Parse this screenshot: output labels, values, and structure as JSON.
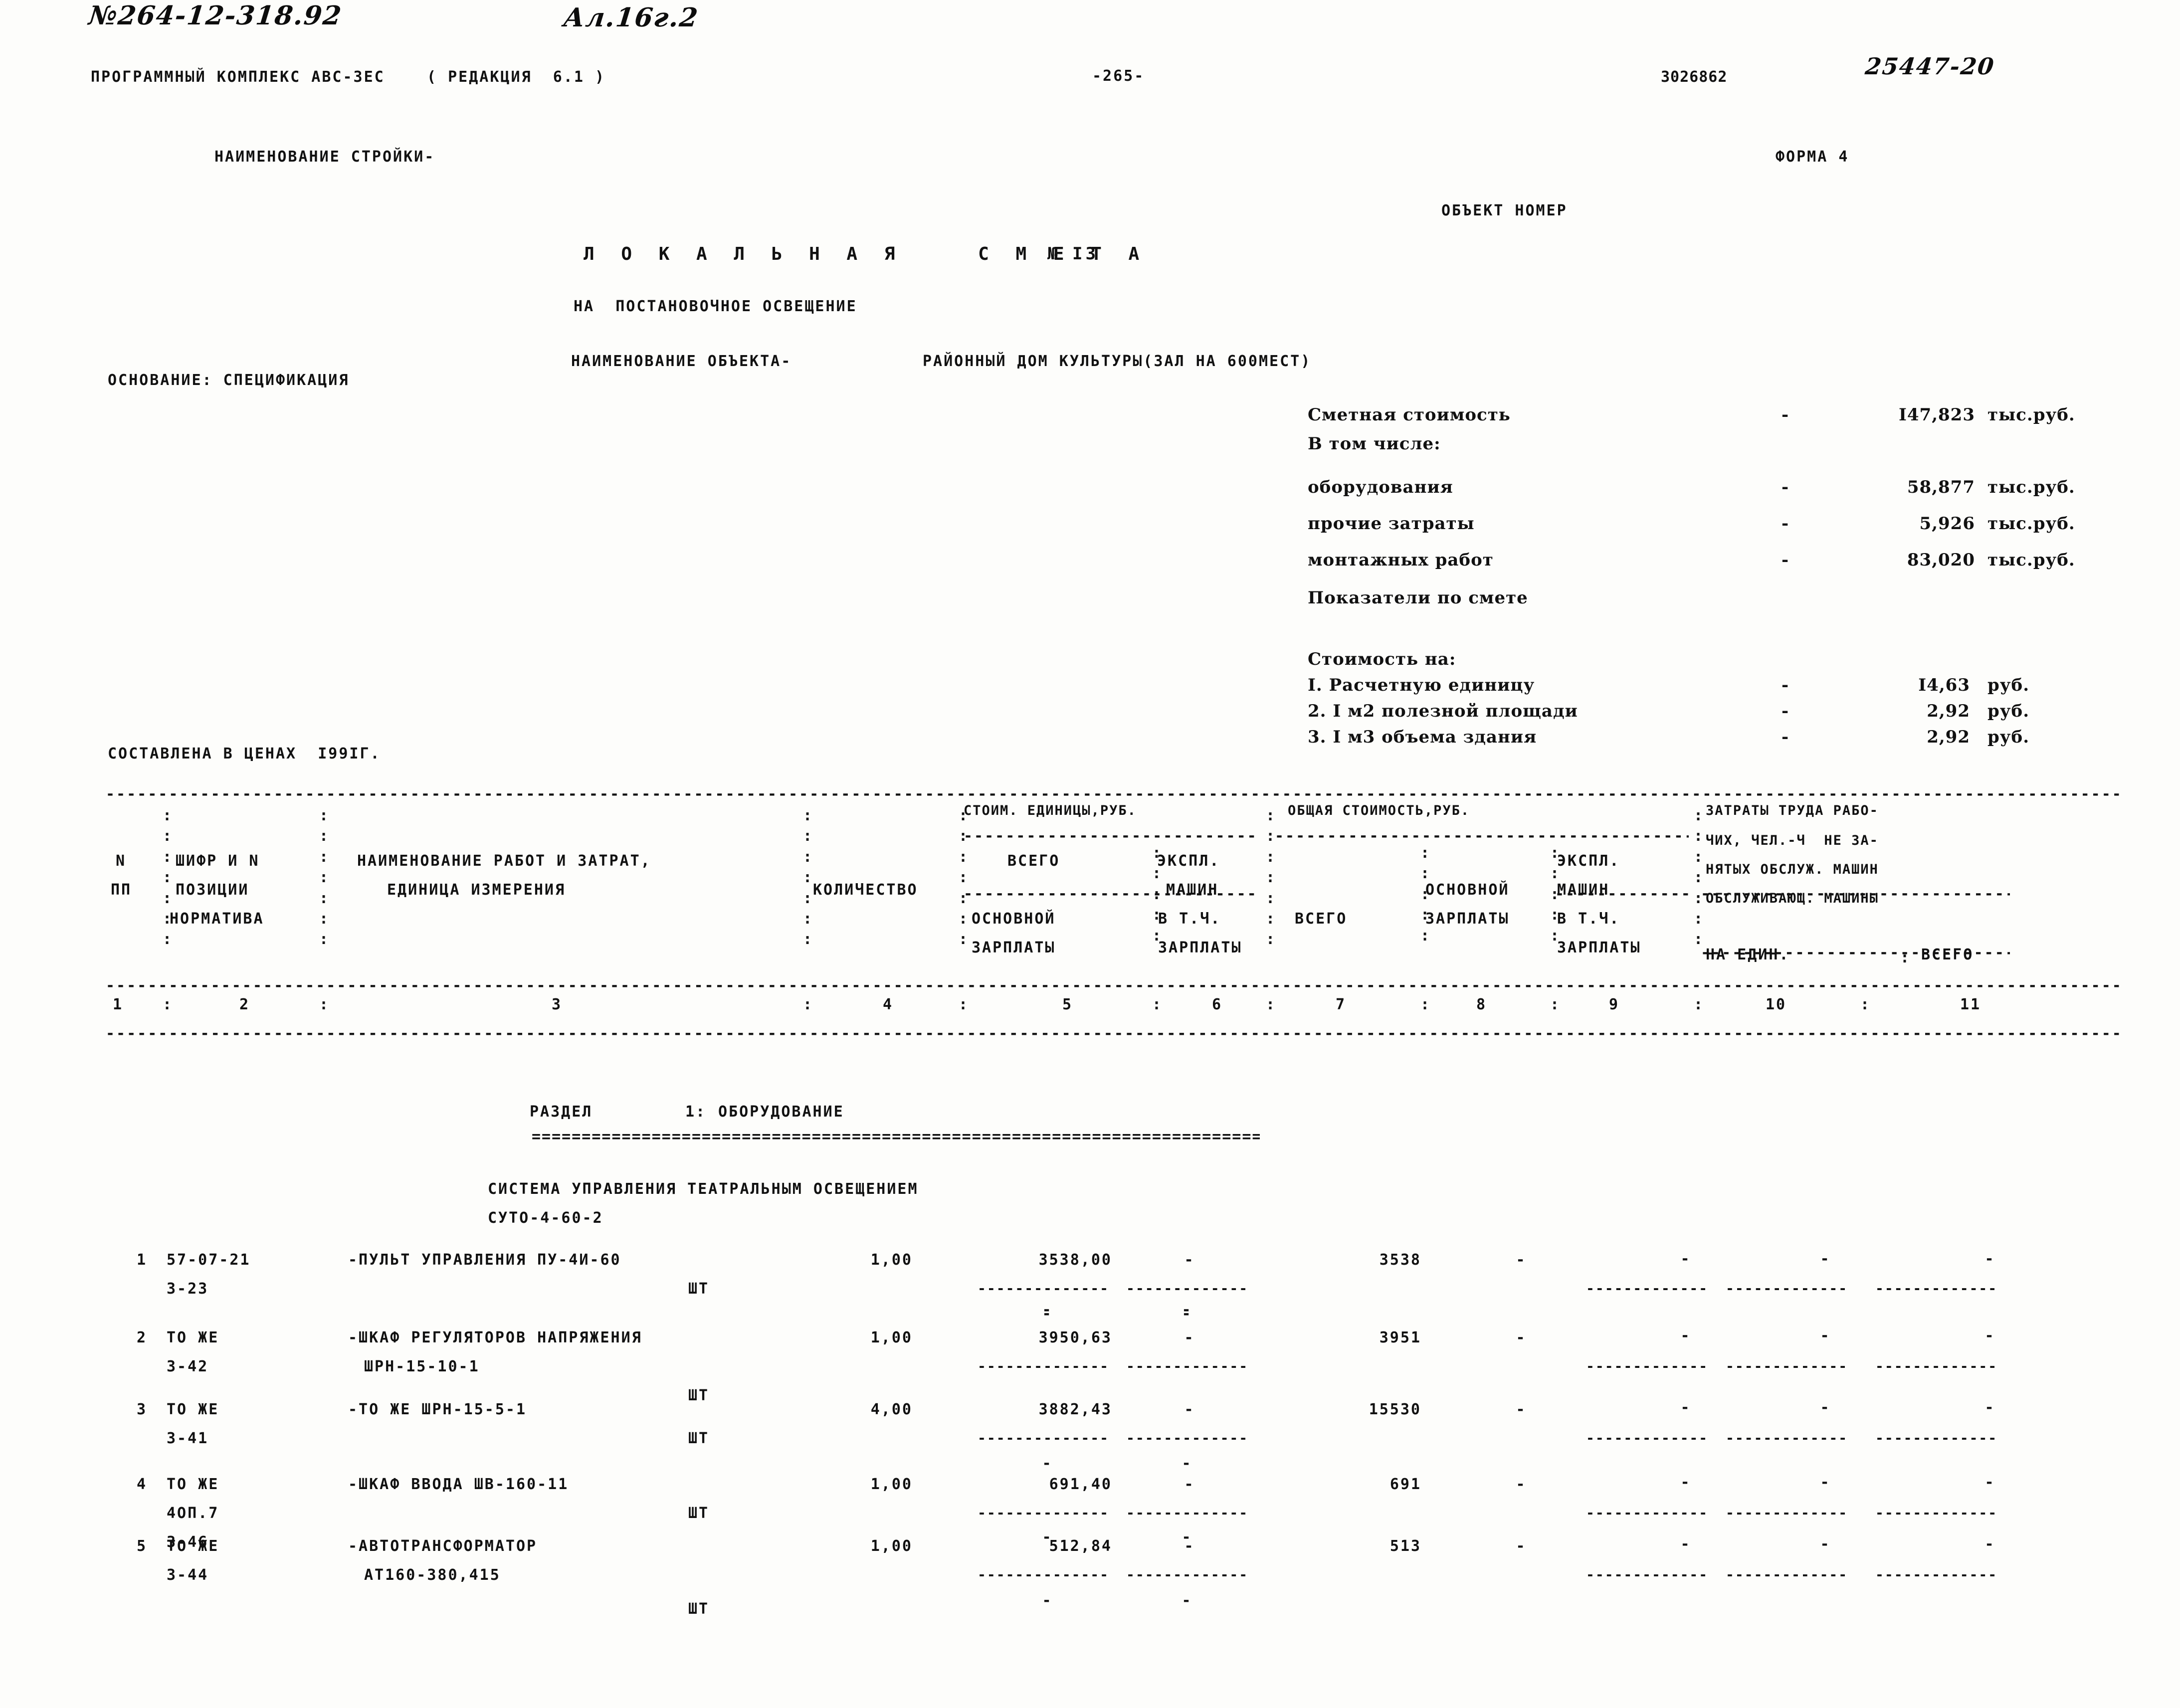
{
  "document": {
    "handwritten_top_left": "№264-12-318.92",
    "handwritten_top_left2": "Ал.16г.2",
    "software_line": "ПРОГРАММНЫЙ КОМПЛЕКС АВС-3ЕС    ( РЕДАКЦИЯ  6.1 )",
    "page_number": "-265-",
    "printed_code": "3026862",
    "handwritten_code": "25447-20",
    "construction_name_label": "НАИМЕНОВАНИЕ СТРОЙКИ-",
    "form_label": "ФОРМА 4",
    "object_number_label": "ОБЪЕКТ НОМЕР",
    "basis_label": "ОСНОВАНИЕ: СПЕЦИФИКАЦИЯ",
    "prices_line": "СОСТАВЛЕНА В ЦЕНАХ  I99IГ."
  },
  "title": {
    "main": "Л О К А Л Ь Н А Я    С М Е Т А",
    "number_prefix": "№",
    "number": "I3",
    "subtitle": "НА  ПОСТАНОВОЧНОЕ ОСВЕЩЕНИЕ",
    "object_label": "НАИМЕНОВАНИЕ ОБЪЕКТА-",
    "object_value": "РАЙОННЫЙ ДОМ КУЛЬТУРЫ(ЗАЛ НА 600МЕСТ)"
  },
  "summary": {
    "rows": [
      {
        "label": "Сметная стоимость",
        "dash": "-",
        "value": "I47,823",
        "unit": "тыс.руб."
      },
      {
        "label": "В том числе:",
        "dash": "",
        "value": "",
        "unit": ""
      },
      {
        "label": "оборудования",
        "dash": "-",
        "value": "58,877",
        "unit": "тыс.руб."
      },
      {
        "label": "прочие затраты",
        "dash": "-",
        "value": "5,926",
        "unit": "тыс.руб."
      },
      {
        "label": "монтажных работ",
        "dash": "-",
        "value": "83,020",
        "unit": "тыс.руб."
      },
      {
        "label": "Показатели по смете",
        "dash": "",
        "value": "",
        "unit": ""
      }
    ],
    "indicators_header": "Стоимость на:",
    "indicators": [
      {
        "label": "I. Расчетную единицу",
        "dash": "-",
        "value": "I4,63",
        "unit": "руб."
      },
      {
        "label": "2. I м2 полезной площади",
        "dash": "-",
        "value": "2,92",
        "unit": "руб."
      },
      {
        "label": "3. I м3 объема здания",
        "dash": "-",
        "value": "2,92",
        "unit": "руб."
      }
    ]
  },
  "table": {
    "group_headers": {
      "unit_cost": "СТОИМ. ЕДИНИЦЫ,РУБ.",
      "total_cost": "ОБЩАЯ СТОИМОСТЬ,РУБ.",
      "labour": "ЗАТРАТЫ ТРУДА РАБО-",
      "labour2": "ЧИХ, ЧЕЛ.-Ч  НЕ ЗА-",
      "labour3": "НЯТЫХ ОБСЛУЖ. МАШИН",
      "labour4": "ОБСЛУЖИВАЮЩ. МАШИНЫ"
    },
    "headers": {
      "c1a": "N",
      "c1b": "ПП",
      "c2a": "ШИФР И N",
      "c2b": "ПОЗИЦИИ",
      "c2c": "НОРМАТИВА",
      "c3a": "НАИМЕНОВАНИЕ РАБОТ И ЗАТРАТ,",
      "c3b": "ЕДИНИЦА ИЗМЕРЕНИЯ",
      "c4": "КОЛИЧЕСТВО",
      "c5a": "ВСЕГО",
      "c5b": "ОСНОВНОЙ",
      "c5c": "ЗАРПЛАТЫ",
      "c6a": "ЭКСПЛ.",
      "c6b": "МАШИН",
      "c6c": "В Т.Ч.",
      "c6d": "ЗАРПЛАТЫ",
      "c7": "ВСЕГО",
      "c8a": "ОСНОВНОЙ",
      "c8b": "ЗАРПЛАТЫ",
      "c9a": "ЭКСПЛ.",
      "c9b": "МАШИН",
      "c9c": "В Т.Ч.",
      "c9d": "ЗАРПЛАТЫ",
      "c10": "НА ЕДИН.",
      "c11": "ВСЕГО"
    },
    "column_numbers": [
      "1",
      "2",
      "3",
      "4",
      "5",
      "6",
      "7",
      "8",
      "9",
      "10",
      "11"
    ]
  },
  "section": {
    "label": "РАЗДЕЛ",
    "number": "1:",
    "name": "ОБОРУДОВАНИЕ",
    "subtitle1": "СИСТЕМА УПРАВЛЕНИЯ ТЕАТРАЛЬНЫМ ОСВЕЩЕНИЕМ",
    "subtitle2": "СУТО-4-60-2"
  },
  "rows": [
    {
      "num": "1",
      "code1": "57-07-21",
      "code2": "3-23",
      "code3": "",
      "name": "-ПУЛЬТ УПРАВЛЕНИЯ ПУ-4И-60",
      "name2": "",
      "unit": "ШТ",
      "qty": "1,00",
      "unit_cost_total": "3538,00",
      "unit_cost_mach": "-",
      "total": "3538",
      "total_wage": "-",
      "total_mach": "-",
      "labour_unit": "-",
      "labour_all": "-",
      "serv_unit": "-",
      "serv_all": "-"
    },
    {
      "num": "2",
      "code1": "ТО ЖЕ",
      "code2": "3-42",
      "code3": "",
      "name": "-ШКАФ РЕГУЛЯТОРОВ НАПРЯЖЕНИЯ",
      "name2": "ШРН-15-10-1",
      "unit": "ШТ",
      "qty": "1,00",
      "unit_cost_total": "3950,63",
      "unit_cost_mach": "-",
      "total": "3951",
      "total_wage": "-",
      "total_mach": "-",
      "labour_unit": "-",
      "labour_all": "-",
      "serv_unit": "-",
      "serv_all": "-"
    },
    {
      "num": "3",
      "code1": "ТО ЖЕ",
      "code2": "3-41",
      "code3": "",
      "name": "-ТО ЖЕ ШРН-15-5-1",
      "name2": "",
      "unit": "ШТ",
      "qty": "4,00",
      "unit_cost_total": "3882,43",
      "unit_cost_mach": "-",
      "total": "15530",
      "total_wage": "-",
      "total_mach": "-",
      "labour_unit": "-",
      "labour_all": "-",
      "serv_unit": "-",
      "serv_all": "-"
    },
    {
      "num": "4",
      "code1": "ТО ЖЕ",
      "code2": "4ОП.7",
      "code3": "3-46",
      "name": "-ШКАФ ВВОДА ШВ-160-11",
      "name2": "",
      "unit": "ШТ",
      "qty": "1,00",
      "unit_cost_total": "691,40",
      "unit_cost_mach": "-",
      "total": "691",
      "total_wage": "-",
      "total_mach": "-",
      "labour_unit": "-",
      "labour_all": "-",
      "serv_unit": "-",
      "serv_all": "-"
    },
    {
      "num": "5",
      "code1": "ТО ЖЕ",
      "code2": "3-44",
      "code3": "",
      "name": "-АВТОТРАНСФОРМАТОР",
      "name2": "АТ160-380,415",
      "unit": "ШТ",
      "qty": "1,00",
      "unit_cost_total": "512,84",
      "unit_cost_mach": "-",
      "total": "513",
      "total_wage": "-",
      "total_mach": "-",
      "labour_unit": "-",
      "labour_all": "-",
      "serv_unit": "-",
      "serv_all": "-"
    }
  ]
}
